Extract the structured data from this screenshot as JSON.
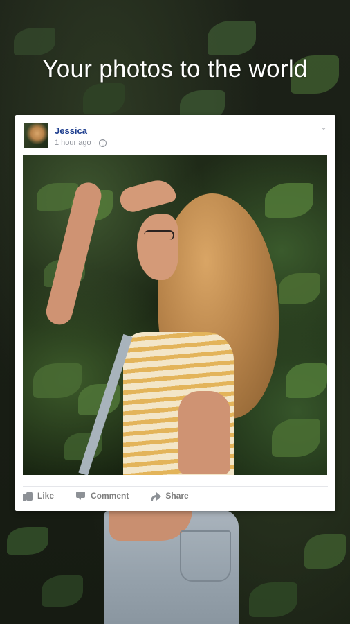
{
  "headline": "Your photos to the world",
  "post": {
    "author": "Jessica",
    "time": "1 hour ago",
    "separator": "·",
    "audience_icon": "globe-icon",
    "menu_icon": "chevron-down-icon"
  },
  "actions": [
    {
      "label": "Like",
      "icon": "thumbs-up-icon"
    },
    {
      "label": "Comment",
      "icon": "comment-icon"
    },
    {
      "label": "Share",
      "icon": "share-arrow-icon"
    }
  ],
  "colors": {
    "author": "#1f3f8f",
    "meta": "#90949c",
    "action": "#7f7f7f",
    "card": "#ffffff"
  }
}
